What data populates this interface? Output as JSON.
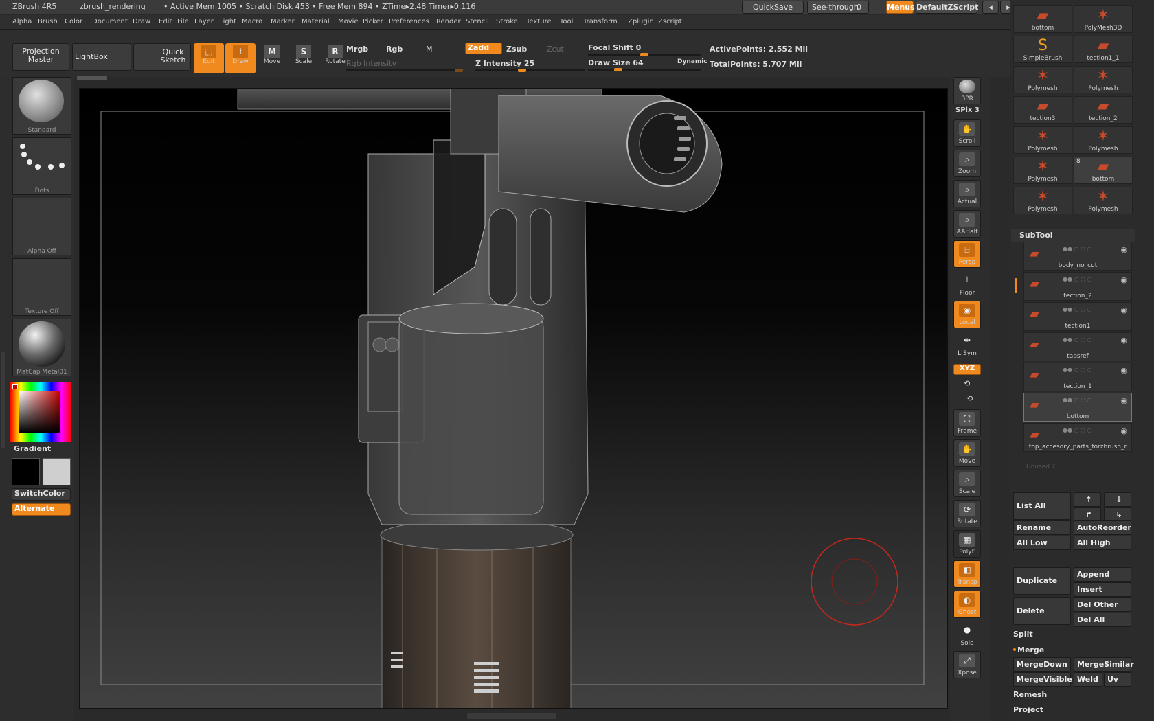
{
  "titlebar": {
    "app": "ZBrush 4R5",
    "doc": "zbrush_rendering",
    "stats": "• Active Mem 1005 • Scratch Disk 453 • Free Mem 894 • ZTime▸2.48 Timer▸0.116",
    "quicksave": "QuickSave",
    "seethrough": "See-through",
    "seethrough_value": "0",
    "menus": "Menus",
    "script": "DefaultZScript"
  },
  "menubar": [
    "Alpha",
    "Brush",
    "Color",
    "Document",
    "Draw",
    "Edit",
    "File",
    "Layer",
    "Light",
    "Macro",
    "Marker",
    "Material",
    "Movie",
    "Picker",
    "Preferences",
    "Render",
    "Stencil",
    "Stroke",
    "Texture",
    "Tool",
    "Transform",
    "Zplugin",
    "Zscript"
  ],
  "toolshelf": {
    "projection_master": "Projection Master",
    "lightbox": "LightBox",
    "quick_sketch": "Quick Sketch",
    "edit": "Edit",
    "draw": "Draw",
    "move": "Move",
    "scale": "Scale",
    "rotate": "Rotate",
    "mrgb": "Mrgb",
    "rgb": "Rgb",
    "m": "M",
    "zadd": "Zadd",
    "zsub": "Zsub",
    "zcut": "Zcut",
    "rgb_intensity": "Rgb Intensity",
    "z_intensity": "Z Intensity 25",
    "focal_shift": "Focal Shift 0",
    "draw_size": "Draw Size 64",
    "dynamic": "Dynamic",
    "active_points": "ActivePoints: 2.552 Mil",
    "total_points": "TotalPoints: 5.707 Mil"
  },
  "leftshelf": {
    "brush": "Standard",
    "stroke": "Dots",
    "alpha": "Alpha Off",
    "texture": "Texture Off",
    "material": "MatCap Metal01",
    "gradient": "Gradient",
    "switchcolor": "SwitchColor",
    "alternate": "Alternate"
  },
  "rightshelf": {
    "bpr": "BPR",
    "spix": "SPix 3",
    "scroll": "Scroll",
    "zoom": "Zoom",
    "actual": "Actual",
    "aahalf": "AAHalf",
    "persp": "Persp",
    "floor": "Floor",
    "local": "Local",
    "lsym": "L.Sym",
    "xyz": "XYZ",
    "frame": "Frame",
    "move": "Move",
    "scale": "Scale",
    "rotate": "Rotate",
    "polyf": "PolyF",
    "transp": "Transp",
    "ghost": "Ghost",
    "solo": "Solo",
    "xpose": "Xpose"
  },
  "tool_grid": [
    {
      "name": "bottom"
    },
    {
      "name": "PolyMesh3D"
    },
    {
      "name": "SimpleBrush"
    },
    {
      "name": "tection1_1"
    },
    {
      "name": "Polymesh"
    },
    {
      "name": "Polymesh"
    },
    {
      "name": "tection3"
    },
    {
      "name": "tection_2"
    },
    {
      "name": "Polymesh"
    },
    {
      "name": "Polymesh"
    },
    {
      "name": "Polymesh"
    },
    {
      "name": "bottom",
      "badge": "8"
    },
    {
      "name": "Polymesh"
    },
    {
      "name": "Polymesh"
    }
  ],
  "subtool": {
    "title": "SubTool",
    "items": [
      "body_no_cut",
      "tection_2",
      "tection1",
      "tabsref",
      "tection_1",
      "bottom",
      "top_accesory_parts_forzbrush_r"
    ],
    "unused": "Unused 7",
    "list_all": "List All",
    "rename": "Rename",
    "autoreorder": "AutoReorder",
    "all_low": "All Low",
    "all_high": "All High",
    "duplicate": "Duplicate",
    "append": "Append",
    "insert": "Insert",
    "delete": "Delete",
    "del_other": "Del Other",
    "del_all": "Del All",
    "split": "Split",
    "merge": "Merge",
    "mergedown": "MergeDown",
    "mergesimilar": "MergeSimilar",
    "mergevisible": "MergeVisible",
    "weld": "Weld",
    "uv": "Uv",
    "remesh": "Remesh",
    "project": "Project"
  },
  "colors": {
    "accent": "#f08a1f",
    "mesh": "#c64a2c"
  }
}
